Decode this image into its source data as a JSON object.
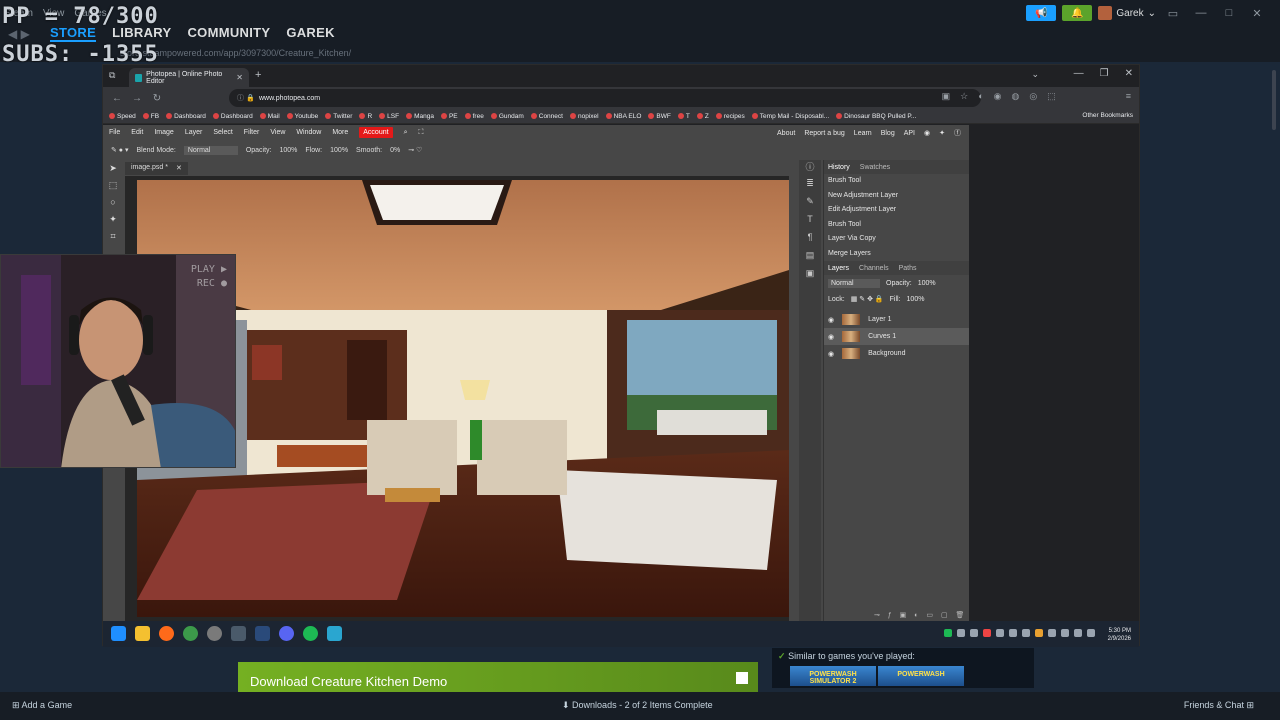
{
  "overlay": {
    "pp": "PP = 78/300",
    "subs": "SUBS: -1355"
  },
  "steam": {
    "menu": [
      "Steam",
      "View",
      "Games"
    ],
    "nav": [
      {
        "label": "STORE",
        "active": true
      },
      {
        "label": "LIBRARY",
        "active": false
      },
      {
        "label": "COMMUNITY",
        "active": false
      },
      {
        "label": "GAREK",
        "active": false
      }
    ],
    "url": "store.steampowered.com/app/3097300/Creature_Kitchen/",
    "username": "Garek",
    "download_button": "Download Creature Kitchen Demo",
    "similar_heading": "Similar to games you've played:",
    "similar_games": [
      "POWERWASH SIMULATOR 2",
      "POWERWASH"
    ],
    "add_game": "Add a Game",
    "downloads": "Downloads - 2 of 2 Items Complete",
    "friends": "Friends & Chat"
  },
  "browser": {
    "tab_title": "Photopea | Online Photo Editor",
    "url": "www.photopea.com",
    "bookmarks": [
      "Speed",
      "FB",
      "Dashboard",
      "Dashboard",
      "Mail",
      "Youtube",
      "Twitter",
      "R",
      "LSF",
      "Manga",
      "PE",
      "free",
      "Gundam",
      "Connect",
      "nopixel",
      "NBA ELO",
      "BWF",
      "T",
      "Z",
      "recipes",
      "Temp Mail - Disposabl...",
      "Dinosaur BBQ Pulled P..."
    ],
    "other_bookmarks": "Other Bookmarks"
  },
  "photopea": {
    "menu": [
      "File",
      "Edit",
      "Image",
      "Layer",
      "Select",
      "Filter",
      "View",
      "Window",
      "More"
    ],
    "account": "Account",
    "right_links": [
      "About",
      "Report a bug",
      "Learn",
      "Blog",
      "API"
    ],
    "options": {
      "blend_label": "Blend Mode:",
      "blend_value": "Normal",
      "opacity_label": "Opacity:",
      "opacity_value": "100%",
      "flow_label": "Flow:",
      "flow_value": "100%",
      "smooth_label": "Smooth:",
      "smooth_value": "0%"
    },
    "doc_tab": "image.psd *",
    "panel_tabs_top": [
      {
        "label": "History",
        "on": true
      },
      {
        "label": "Swatches",
        "on": false
      }
    ],
    "history": [
      "Brush Tool",
      "New Adjustment Layer",
      "Edit Adjustment Layer",
      "Brush Tool",
      "Layer Via Copy",
      "Merge Layers"
    ],
    "panel_tabs_layers": [
      {
        "label": "Layers",
        "on": true
      },
      {
        "label": "Channels",
        "on": false
      },
      {
        "label": "Paths",
        "on": false
      }
    ],
    "layer_blend": "Normal",
    "layer_opacity_label": "Opacity:",
    "layer_opacity": "100%",
    "lock_label": "Lock:",
    "fill_label": "Fill:",
    "fill": "100%",
    "layers": [
      {
        "name": "Layer 1",
        "selected": false
      },
      {
        "name": "Curves 1",
        "selected": true
      },
      {
        "name": "Background",
        "selected": false
      }
    ]
  },
  "webcam": {
    "play": "PLAY ▶",
    "rec": "REC ●"
  },
  "clock": {
    "time": "5:30 PM",
    "date": "2/9/2026"
  }
}
